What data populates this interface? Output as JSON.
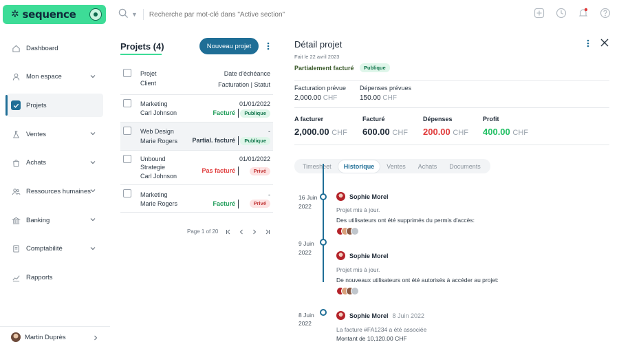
{
  "brand": {
    "name": "sequence"
  },
  "search": {
    "placeholder": "Recherche par mot-clé dans \"Active section\""
  },
  "top_icons": [
    "plus-square-icon",
    "clock-icon",
    "bell-icon",
    "help-icon"
  ],
  "sidebar": {
    "items": [
      {
        "label": "Dashboard",
        "icon": "dashboard-icon",
        "chevron": false,
        "active": false
      },
      {
        "label": "Mon espace",
        "icon": "user-icon",
        "chevron": true,
        "active": false
      },
      {
        "label": "Projets",
        "icon": "checkbox-icon",
        "chevron": false,
        "active": true
      },
      {
        "label": "Ventes",
        "icon": "flask-icon",
        "chevron": true,
        "active": false
      },
      {
        "label": "Achats",
        "icon": "bag-icon",
        "chevron": true,
        "active": false
      },
      {
        "label": "Ressources humaines",
        "icon": "team-icon",
        "chevron": true,
        "active": false
      },
      {
        "label": "Banking",
        "icon": "bank-icon",
        "chevron": true,
        "active": false
      },
      {
        "label": "Comptabilité",
        "icon": "ledger-icon",
        "chevron": true,
        "active": false
      },
      {
        "label": "Rapports",
        "icon": "chart-icon",
        "chevron": false,
        "active": false
      }
    ],
    "user": {
      "name": "Martin Duprès"
    }
  },
  "projects": {
    "title": "Projets (4)",
    "new_button": "Nouveau projet",
    "header": {
      "col1_line1": "Projet",
      "col1_line2": "Client",
      "col2_line1": "Date d'échéance",
      "col2_line2": "Facturation | Statut"
    },
    "rows": [
      {
        "lines": [
          "Marketing",
          "Carl Johnson"
        ],
        "date": "01/01/2022",
        "status": "Facturé",
        "visibility": "Publique"
      },
      {
        "lines": [
          "Web Design",
          "Marie Rogers"
        ],
        "date": "-",
        "status": "Partial. facturé",
        "visibility": "Publique"
      },
      {
        "lines": [
          "Unbound",
          "Strategie",
          "Carl Johnson"
        ],
        "date": "01/01/2022",
        "status": "Pas facturé",
        "visibility": "Privé"
      },
      {
        "lines": [
          "Marketing",
          "Marie Rogers"
        ],
        "date": "-",
        "status": "Facturé",
        "visibility": "Privé"
      }
    ],
    "pager": "Page 1 of 20"
  },
  "detail": {
    "title": "Détail projet",
    "date": "Fait le 22 avril 2023",
    "billing_status": "Partialement facturé",
    "visibility": "Publique",
    "expected_billing_label": "Facturation prévue",
    "expected_billing_value": "2,000.00",
    "expected_expenses_label": "Dépenses prévues",
    "expected_expenses_value": "150.00",
    "currency": "CHF",
    "stats": [
      {
        "label": "A facturer",
        "value": "2,000.00",
        "color": "#1f2a37"
      },
      {
        "label": "Facturé",
        "value": "600.00",
        "color": "#1f2a37"
      },
      {
        "label": "Dépenses",
        "value": "200.00",
        "color": "#e03a3a"
      },
      {
        "label": "Profit",
        "value": "400.00",
        "color": "#1fbf62"
      }
    ],
    "tabs": [
      "Timesheet",
      "Historique",
      "Ventes",
      "Achats",
      "Documents"
    ],
    "active_tab": "Historique",
    "timeline": [
      {
        "date_day": "16 Juin",
        "date_year": "2022",
        "user": "Sophie Morel",
        "user_date": "",
        "line1": "Projet mis à jour.",
        "line2": "Des utilisateurs ont été supprimés du permis d'accès:",
        "avatars": true
      },
      {
        "date_day": "9 Juin",
        "date_year": "2022",
        "user": "Sophie Morel",
        "user_date": "",
        "line1": "Projet mis à jour.",
        "line2": "De nouveaux utilisateurs ont été autorisés à accéder au projet:",
        "avatars": true
      },
      {
        "date_day": "8 Juin",
        "date_year": "2022",
        "user": "Sophie Morel",
        "user_date": "8 Juin 2022",
        "line1": "La facture #FA1234 a été associée",
        "line2": "Montant de 10,120.00 CHF",
        "avatars": false
      }
    ]
  }
}
